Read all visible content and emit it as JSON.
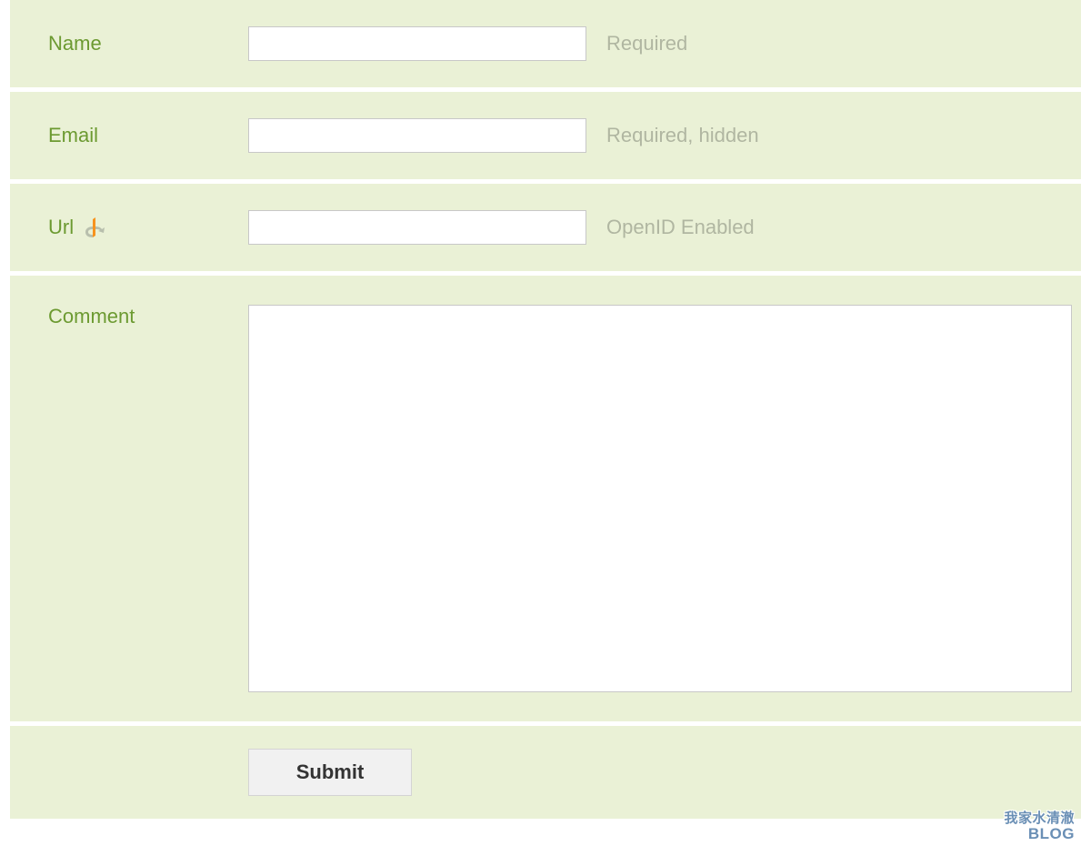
{
  "form": {
    "name": {
      "label": "Name",
      "value": "",
      "hint": "Required"
    },
    "email": {
      "label": "Email",
      "value": "",
      "hint": "Required, hidden"
    },
    "url": {
      "label": "Url",
      "value": "",
      "hint": "OpenID Enabled"
    },
    "comment": {
      "label": "Comment",
      "value": ""
    },
    "submit": {
      "label": "Submit"
    }
  },
  "watermark": {
    "line1": "我家水清澈",
    "line2": "BLOG"
  },
  "icons": {
    "openid": "openid-icon"
  }
}
